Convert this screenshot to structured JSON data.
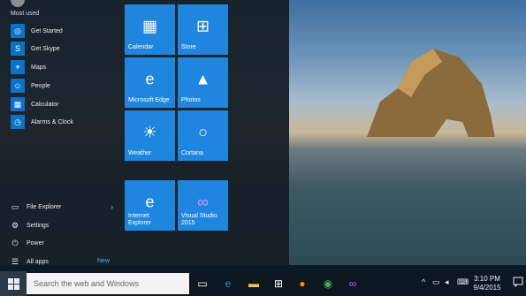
{
  "menu": {
    "section_label": "Most used",
    "most_used": [
      {
        "label": "Get Started",
        "icon": "lightbulb-icon"
      },
      {
        "label": "Get Skype",
        "icon": "skype-icon"
      },
      {
        "label": "Maps",
        "icon": "map-icon"
      },
      {
        "label": "People",
        "icon": "people-icon"
      },
      {
        "label": "Calculator",
        "icon": "calculator-icon"
      },
      {
        "label": "Alarms & Clock",
        "icon": "alarm-clock-icon"
      }
    ],
    "bottom": [
      {
        "label": "File Explorer",
        "icon": "file-explorer-icon"
      },
      {
        "label": "Settings",
        "icon": "gear-icon"
      },
      {
        "label": "Power",
        "icon": "power-icon"
      },
      {
        "label": "All apps",
        "icon": "all-apps-icon"
      }
    ],
    "new_badge": "New"
  },
  "tiles": [
    {
      "label": "Calendar",
      "icon": "calendar-icon"
    },
    {
      "label": "Store",
      "icon": "store-icon"
    },
    {
      "label": "Microsoft Edge",
      "icon": "edge-icon"
    },
    {
      "label": "Photos",
      "icon": "photos-icon"
    },
    {
      "label": "Weather",
      "icon": "weather-icon"
    },
    {
      "label": "Cortana",
      "icon": "cortana-icon"
    },
    {
      "label": "Internet Explorer",
      "icon": "internet-explorer-icon"
    },
    {
      "label": "Visual Studio 2015",
      "icon": "visual-studio-icon"
    }
  ],
  "taskbar": {
    "search_placeholder": "Search the web and Windows",
    "time": "3:10 PM",
    "date": "9/4/2015",
    "pinned": [
      "task-view-icon",
      "edge-icon",
      "file-explorer-icon",
      "store-icon",
      "firefox-icon",
      "chrome-icon",
      "visual-studio-icon"
    ]
  },
  "colors": {
    "tile": "#1f86e0",
    "accent": "#0a72c9",
    "menu_bg": "#171f26"
  }
}
